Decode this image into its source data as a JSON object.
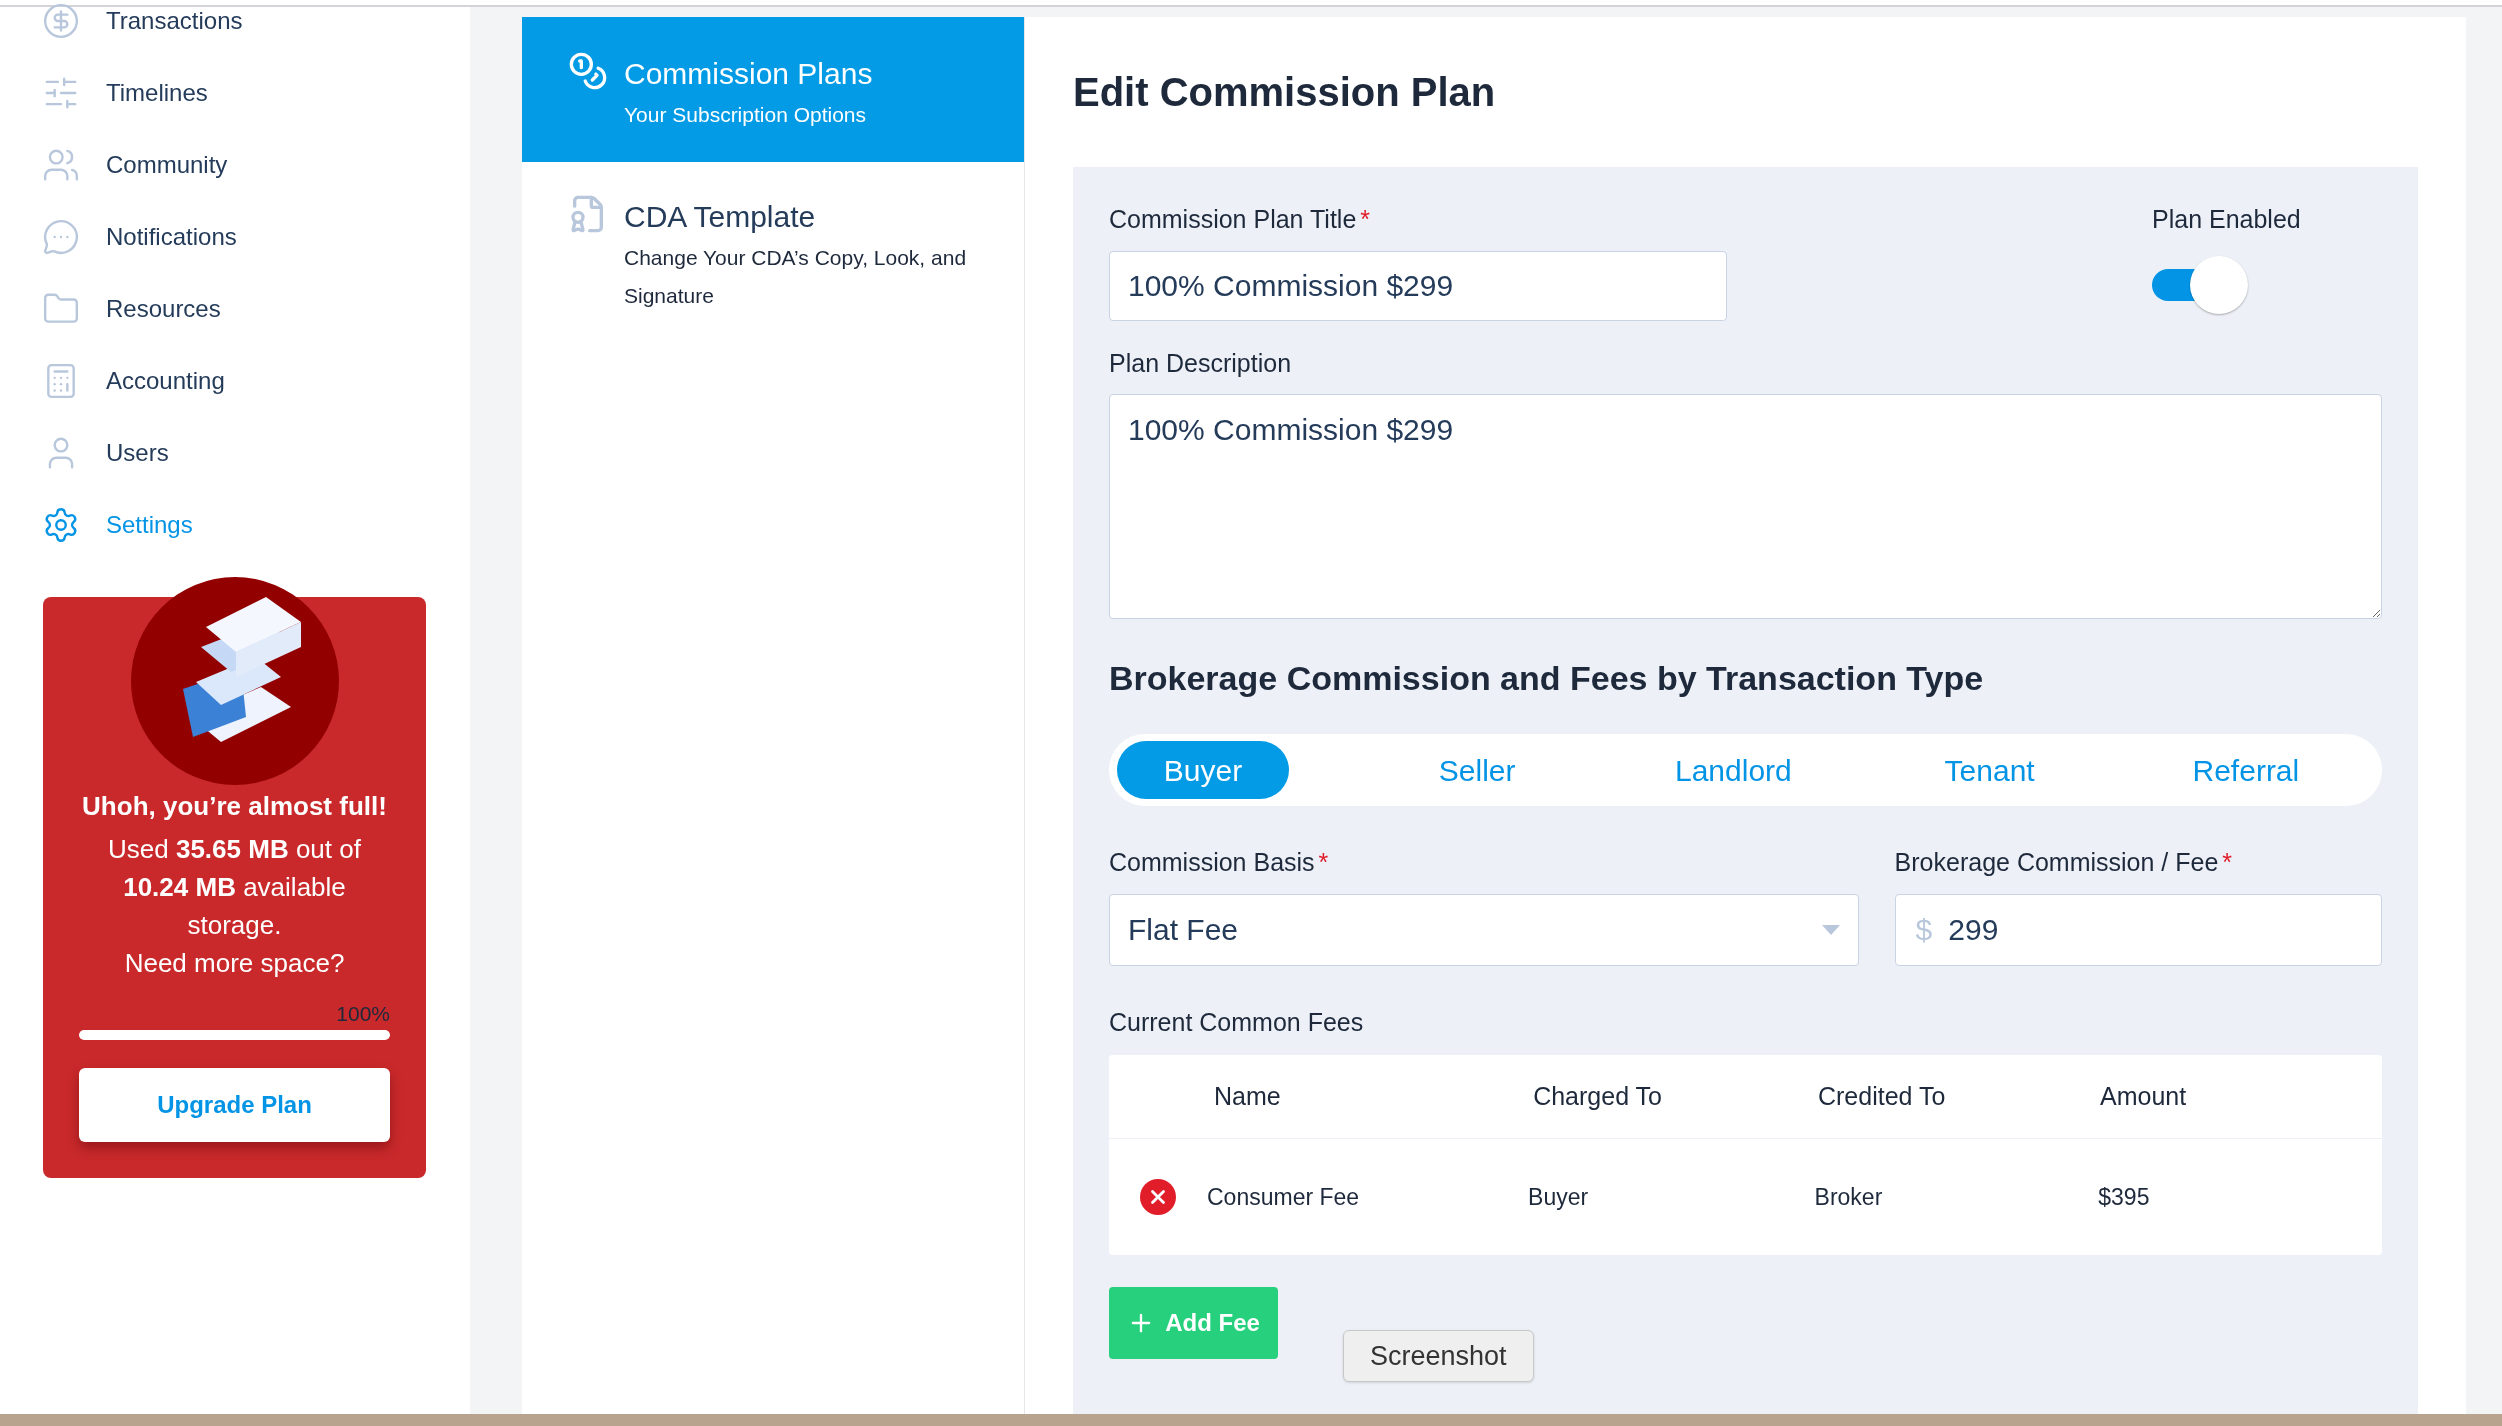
{
  "sidebar": {
    "items": [
      {
        "label": "Transactions",
        "selected": false
      },
      {
        "label": "Timelines",
        "selected": false
      },
      {
        "label": "Community",
        "selected": false
      },
      {
        "label": "Notifications",
        "selected": false
      },
      {
        "label": "Resources",
        "selected": false
      },
      {
        "label": "Accounting",
        "selected": false
      },
      {
        "label": "Users",
        "selected": false
      },
      {
        "label": "Settings",
        "selected": true
      }
    ]
  },
  "storage_card": {
    "title": "Uhoh, you’re almost full!",
    "message": "Used **35.65 MB** out of **10.24 MB** available storage.",
    "question": "Need more space?",
    "percent": "100%",
    "level": 1,
    "button": "Upgrade Plan"
  },
  "settings_menu": [
    {
      "title": "Commission Plans",
      "subtitle": "Your Subscription Options",
      "selected": true
    },
    {
      "title": "CDA Template",
      "subtitle": "Change Your CDA’s Copy, Look, and Signature",
      "selected": false
    }
  ],
  "page_title": "Edit Commission Plan",
  "form": {
    "plan_title": {
      "label": "Commission Plan Title",
      "required": "*",
      "value": "100% Commission $299"
    },
    "plan_enabled": {
      "label": "Plan Enabled",
      "on": true
    },
    "description": {
      "label": "Plan Description",
      "value": "100% Commission $299"
    },
    "section_heading": "Brokerage Commission and Fees by Transaction Type",
    "tabs": [
      {
        "label": "Buyer",
        "selected": true
      },
      {
        "label": "Seller",
        "selected": false
      },
      {
        "label": "Landlord",
        "selected": false
      },
      {
        "label": "Tenant",
        "selected": false
      },
      {
        "label": "Referral",
        "selected": false
      }
    ],
    "commission_basis": {
      "label": "Commission Basis",
      "required": "*",
      "value": "Flat Fee"
    },
    "brokerage_fee": {
      "label": "Brokerage Commission / Fee",
      "required": "*",
      "prefix": "$",
      "value": "299"
    },
    "fees_label": "Current Common Fees",
    "fees_table": {
      "columns": [
        "Name",
        "Charged To",
        "Credited To",
        "Amount"
      ],
      "rows": [
        {
          "cells": [
            "Consumer Fee",
            "Buyer",
            "Broker",
            "$395"
          ]
        }
      ]
    },
    "add_button": "Add Fee"
  },
  "tooltip": "Screenshot"
}
